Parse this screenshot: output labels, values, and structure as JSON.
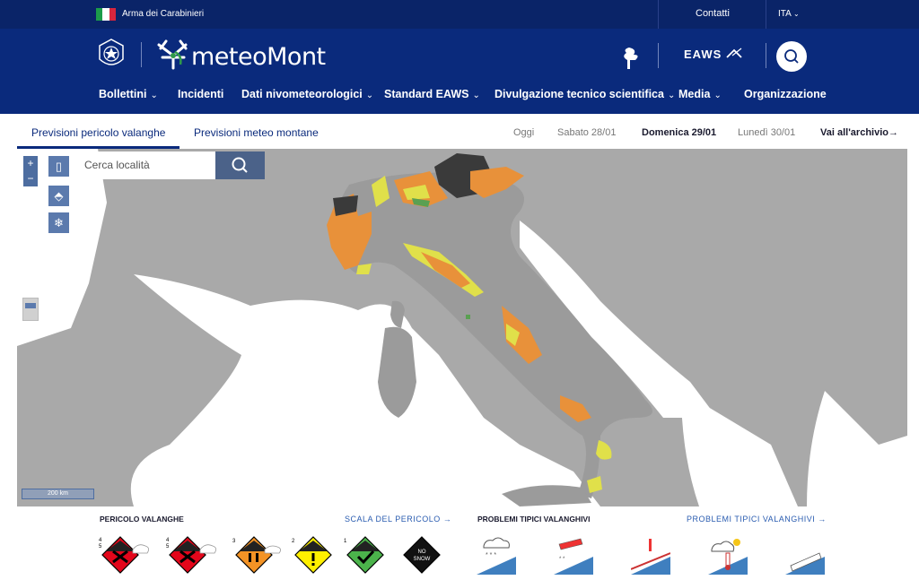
{
  "topbar": {
    "arma_label": "Arma dei Carabinieri",
    "contatti": "Contatti",
    "lang": "ITA"
  },
  "header": {
    "logo_text": "meteoMont",
    "eaws_label": "EAWS",
    "nav": [
      {
        "label": "Bollettini",
        "dropdown": true
      },
      {
        "label": "Incidenti",
        "dropdown": false
      },
      {
        "label": "Dati nivometeorologici",
        "dropdown": true
      },
      {
        "label": "Standard EAWS",
        "dropdown": true
      },
      {
        "label": "Divulgazione tecnico scientifica",
        "dropdown": true
      },
      {
        "label": "Media",
        "dropdown": true
      },
      {
        "label": "Organizzazione",
        "dropdown": false
      }
    ]
  },
  "tabs": {
    "active": "Previsioni pericolo valanghe",
    "other": "Previsioni meteo montane"
  },
  "days": [
    "Oggi",
    "Sabato 28/01",
    "Domenica 29/01",
    "Lunedì 30/01"
  ],
  "selected_day": "Domenica 29/01",
  "archive_label": "Vai all'archivio→",
  "map": {
    "search_placeholder": "Cerca località",
    "scale_label": "200 km",
    "zoom_in": "+",
    "zoom_out": "−"
  },
  "legend": {
    "danger_title": "PERICOLO VALANGHE",
    "danger_link": "SCALA DEL PERICOLO →",
    "problems_title": "PROBLEMI TIPICI VALANGHIVI",
    "problems_link": "PROBLEMI TIPICI VALANGHIVI →",
    "levels": [
      "5",
      "4",
      "3",
      "2",
      "1"
    ],
    "level_left": [
      "4",
      "4",
      "3",
      "2",
      "1"
    ],
    "level_right": [
      "5",
      "5",
      "",
      "",
      ""
    ],
    "no_snow_line1": "NO",
    "no_snow_line2": "SNOW"
  },
  "colors": {
    "navy": "#0a2a7c",
    "level5": "#e3061b",
    "level3": "#f39325",
    "level2": "#fff000",
    "level1": "#4bb34b",
    "map_orange": "#e8913a",
    "map_yellow": "#e0e04a",
    "map_green": "#5aa052",
    "map_dark": "#3a3a3a"
  }
}
